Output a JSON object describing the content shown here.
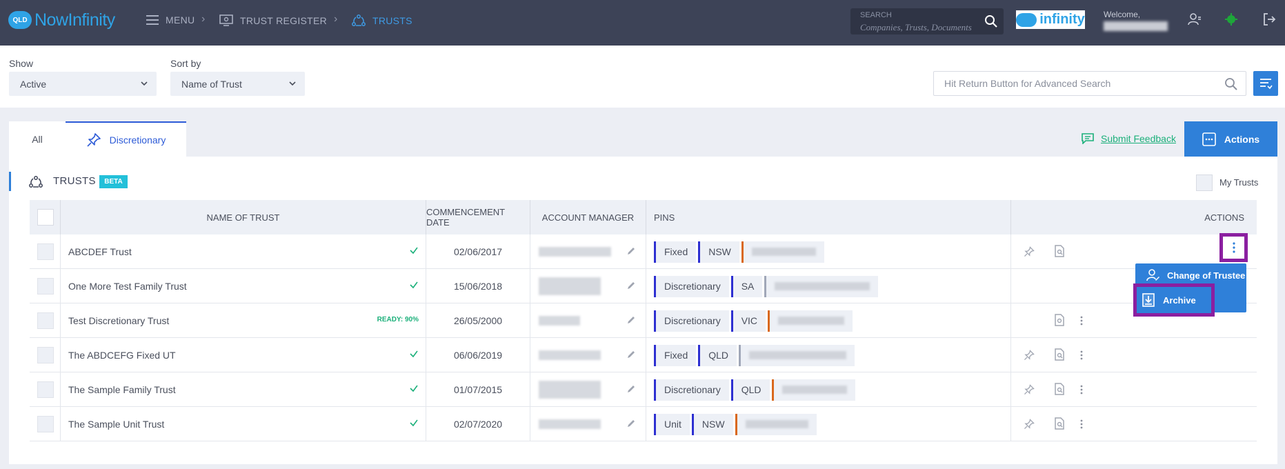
{
  "header": {
    "logo_badge": "QLD",
    "logo_text": "NowInfinity",
    "menu_label": "MENU",
    "trust_register_label": "TRUST REGISTER",
    "trusts_label": "TRUSTS",
    "search_label": "SEARCH",
    "search_placeholder": "Companies, Trusts, Documents",
    "brand_text": "infinity",
    "welcome_label": "Welcome,"
  },
  "filters": {
    "show_label": "Show",
    "show_value": "Active",
    "sort_label": "Sort by",
    "sort_value": "Name of Trust",
    "advanced_search_placeholder": "Hit Return Button for Advanced Search"
  },
  "tabs": {
    "all": "All",
    "discretionary": "Discretionary"
  },
  "toolbar": {
    "feedback_label": "Submit Feedback",
    "actions_label": "Actions"
  },
  "section": {
    "title": "TRUSTS",
    "badge": "BETA",
    "my_trusts_label": "My Trusts"
  },
  "table": {
    "columns": {
      "name": "NAME OF TRUST",
      "date": "COMMENCEMENT DATE",
      "manager": "ACCOUNT MANAGER",
      "pins": "PINS",
      "actions": "ACTIONS"
    },
    "rows": [
      {
        "name": "ABCDEF Trust",
        "status": "ok",
        "date": "02/06/2017",
        "pins": [
          "Fixed",
          "NSW"
        ]
      },
      {
        "name": "One More Test Family Trust",
        "status": "ok",
        "date": "15/06/2018",
        "pins": [
          "Discretionary",
          "SA"
        ]
      },
      {
        "name": "Test Discretionary Trust",
        "status": "READY: 90%",
        "date": "26/05/2000",
        "pins": [
          "Discretionary",
          "VIC"
        ]
      },
      {
        "name": "The ABDCEFG Fixed UT",
        "status": "ok",
        "date": "06/06/2019",
        "pins": [
          "Fixed",
          "QLD"
        ]
      },
      {
        "name": "The Sample Family Trust",
        "status": "ok",
        "date": "01/07/2015",
        "pins": [
          "Discretionary",
          "QLD"
        ]
      },
      {
        "name": "The Sample Unit Trust",
        "status": "ok",
        "date": "02/07/2020",
        "pins": [
          "Unit",
          "NSW"
        ]
      }
    ]
  },
  "row_menu": {
    "change_trustee": "Change of Trustee",
    "archive": "Archive"
  },
  "colors": {
    "topbar": "#3d4357",
    "accent": "#2f80d9",
    "highlight": "#8b1fa0",
    "success": "#1bb07a"
  }
}
